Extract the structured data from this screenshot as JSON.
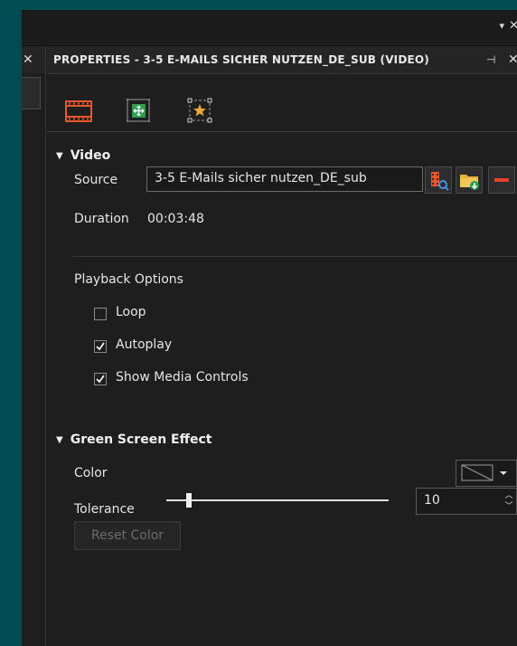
{
  "window": {
    "top_pin": "▾",
    "top_close": "✕"
  },
  "left_panel": {
    "close": "✕"
  },
  "properties": {
    "title": "PROPERTIES - 3-5 E-MAILS SICHER NUTZEN_DE_SUB (VIDEO)",
    "pin": "⊣",
    "close": "✕",
    "tabs": [
      {
        "name": "video-tab-icon",
        "color": "#e8562a"
      },
      {
        "name": "transform-tab-icon",
        "color": "#2e9e4c"
      },
      {
        "name": "effects-tab-icon",
        "color": "#e8a83a"
      }
    ]
  },
  "video": {
    "section": "Video",
    "source_label": "Source",
    "source_value": "3-5 E-Mails sicher nutzen_DE_sub",
    "duration_label": "Duration",
    "duration_value": "00:03:48",
    "playback_label": "Playback Options",
    "options": [
      {
        "label": "Loop",
        "checked": false
      },
      {
        "label": "Autoplay",
        "checked": true
      },
      {
        "label": "Show Media Controls",
        "checked": true
      }
    ]
  },
  "green_screen": {
    "section": "Green Screen Effect",
    "color_label": "Color",
    "tolerance_label": "Tolerance",
    "tolerance_value": "10",
    "tolerance_level_fraction": 0.1,
    "reset_label": "Reset Color"
  },
  "colors": {
    "background": "#004c52",
    "panel": "#1e1e1e",
    "accent_orange": "#e8562a",
    "remove_red": "#e8412a"
  }
}
